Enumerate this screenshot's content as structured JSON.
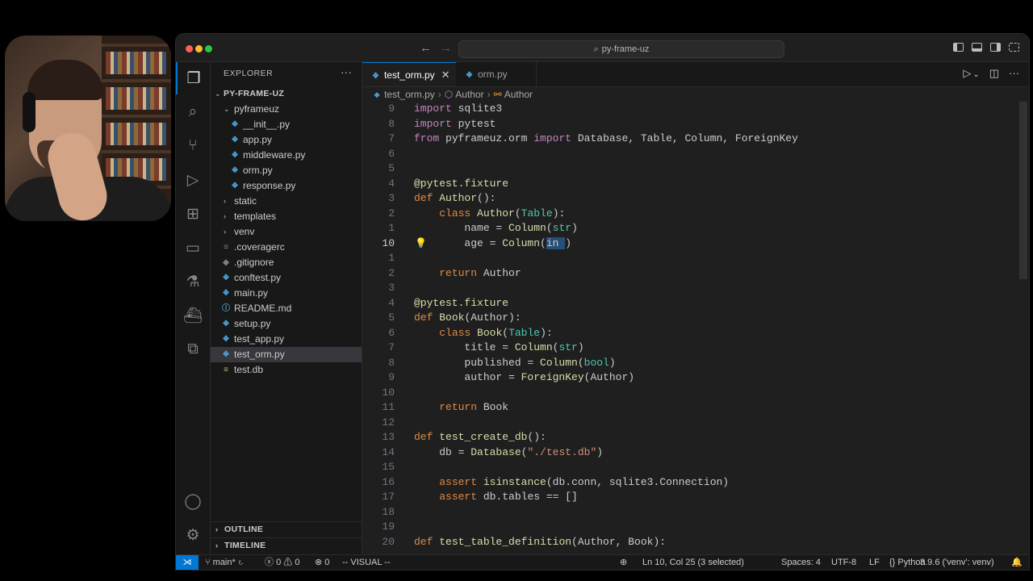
{
  "window": {
    "search": "py-frame-uz"
  },
  "activity_bar": {
    "items": [
      "explorer-icon",
      "search-icon",
      "source-control-icon",
      "run-debug-icon",
      "extensions-icon",
      "remote-explorer-icon",
      "testing-icon",
      "docker-icon",
      "remote-icon"
    ],
    "bottom": [
      "account-icon",
      "manage-gear-icon"
    ]
  },
  "sidebar": {
    "title": "EXPLORER",
    "more": "···",
    "root": "PY-FRAME-UZ",
    "folder_pyframeuz": "pyframeuz",
    "files_pyframeuz": [
      "__init__.py",
      "app.py",
      "middleware.py",
      "orm.py",
      "response.py"
    ],
    "folders_collapsed": [
      "static",
      "templates",
      "venv"
    ],
    "root_files": [
      ".coveragerc",
      ".gitignore",
      "conftest.py",
      "main.py",
      "README.md",
      "setup.py",
      "test_app.py",
      "test_orm.py",
      "test.db"
    ],
    "outline": "OUTLINE",
    "timeline": "TIMELINE"
  },
  "tabs": {
    "active": "test_orm.py",
    "inactive": "orm.py",
    "close": "✕"
  },
  "breadcrumb": {
    "file": "test_orm.py",
    "item1": "Author",
    "item2": "Author"
  },
  "code": {
    "line_numbers": [
      "9",
      "8",
      "7",
      "6",
      "5",
      "4",
      "3",
      "2",
      "1",
      "10",
      "1",
      "2",
      "3",
      "4",
      "5",
      "6",
      "7",
      "8",
      "9",
      "10",
      "11",
      "12",
      "13",
      "14",
      "15",
      "16",
      "17",
      "18",
      "19",
      "20"
    ]
  },
  "statusbar": {
    "branch": "main*",
    "errors": "0",
    "warnings": "0",
    "ports": "0",
    "mode": "-- VISUAL --",
    "position": "Ln 10, Col 25 (3 selected)",
    "spaces": "Spaces: 4",
    "encoding": "UTF-8",
    "eol": "LF",
    "language": "Python",
    "interpreter": "3.9.6 ('venv': venv)"
  },
  "colors": {
    "accent": "#0078d4",
    "selection": "#264f78"
  }
}
